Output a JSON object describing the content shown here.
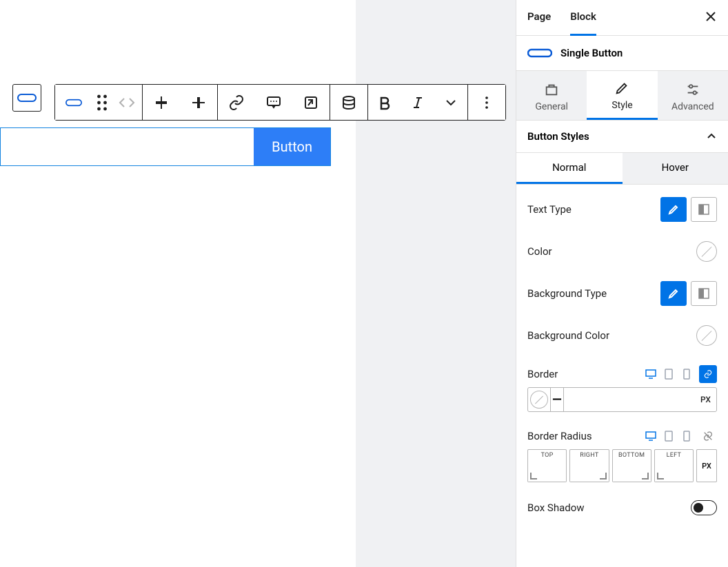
{
  "sidebar": {
    "tabs": {
      "page": "Page",
      "block": "Block"
    },
    "block_name": "Single Button",
    "mode_tabs": {
      "general": "General",
      "style": "Style",
      "advanced": "Advanced"
    },
    "section_title": "Button Styles",
    "subtabs": {
      "normal": "Normal",
      "hover": "Hover"
    },
    "rows": {
      "text_type": "Text Type",
      "color": "Color",
      "background_type": "Background Type",
      "background_color": "Background Color",
      "border": "Border",
      "border_unit": "PX",
      "border_radius": "Border Radius",
      "radius_labels": {
        "top": "TOP",
        "right": "RIGHT",
        "bottom": "BOTTOM",
        "left": "LEFT"
      },
      "radius_unit": "PX",
      "box_shadow": "Box Shadow"
    }
  },
  "canvas": {
    "button_text": "Button"
  },
  "colors": {
    "accent": "#0073e6",
    "button_bg": "#2d7ef7"
  }
}
